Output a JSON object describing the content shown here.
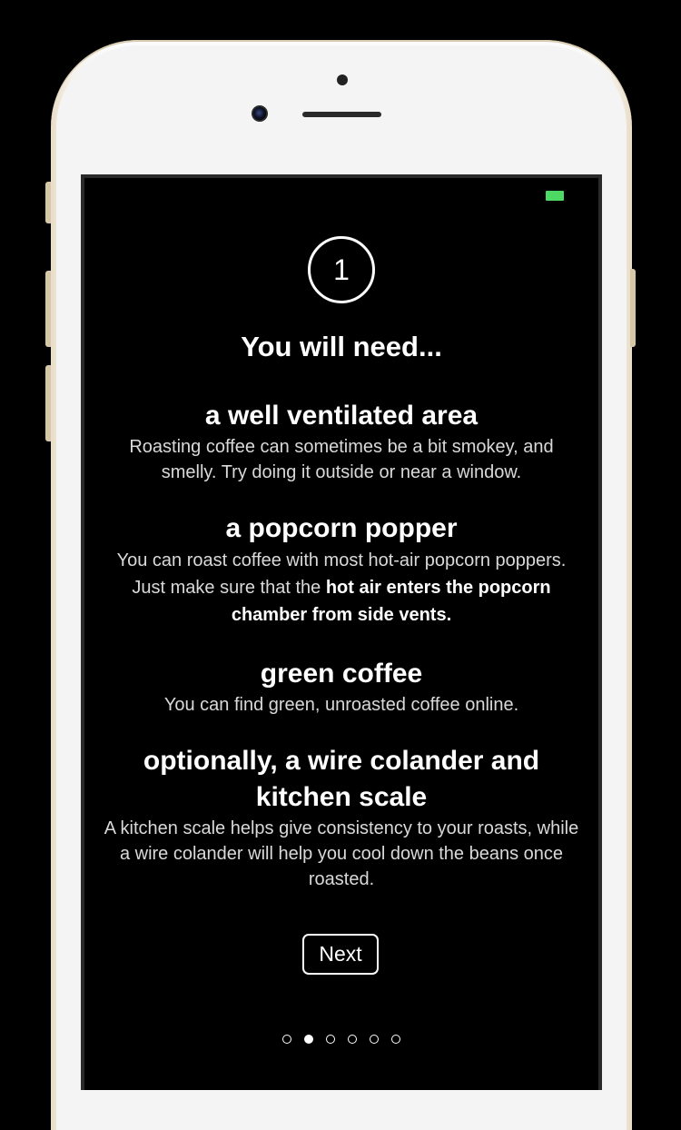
{
  "onboarding": {
    "step_number": "1",
    "title": "You will need...",
    "items": [
      {
        "heading": "a well ventilated area",
        "body": "Roasting coffee can sometimes be a bit smokey, and smelly. Try doing it outside or near a window."
      },
      {
        "heading": "a popcorn popper",
        "body": "You can roast coffee with most hot-air popcorn poppers. Just make sure that the ",
        "body_bold": "hot air enters the popcorn chamber from side vents."
      },
      {
        "heading": "green coffee",
        "body": "You can find green, unroasted coffee online."
      },
      {
        "heading": "optionally, a wire colander and kitchen scale",
        "body": "A kitchen scale helps give consistency to your roasts, while a wire colander will help you cool down the beans once roasted."
      }
    ],
    "next_label": "Next",
    "page_indicator": {
      "count": 6,
      "active_index": 1
    }
  },
  "colors": {
    "background": "#000000",
    "text": "#ffffff",
    "battery": "#4cd964"
  },
  "icons": {
    "battery": "battery-icon",
    "camera": "front-camera-icon"
  }
}
